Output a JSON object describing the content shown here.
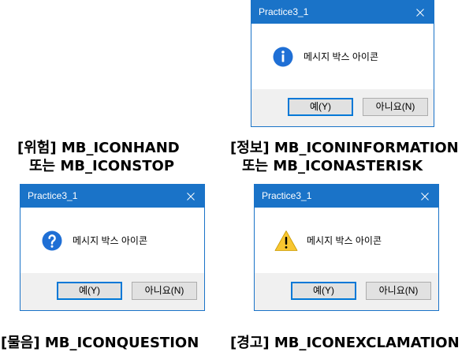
{
  "theme": {
    "title_bar_color": "#1a73c8",
    "button_strip_color": "#f0f0f0",
    "button_color": "#e1e1e1",
    "default_button_border": "#0078d7",
    "information_icon_color": "#1f6fd5",
    "question_icon_color": "#1f6fd5",
    "warning_icon_color": "#f8c630"
  },
  "captions": {
    "hand": {
      "line1": "[위험] MB_ICONHAND",
      "line2": "또는 MB_ICONSTOP"
    },
    "information": {
      "line1": "[정보] MB_ICONINFORMATION",
      "line2": "또는 MB_ICONASTERISK"
    },
    "question": {
      "line1": "[물음] MB_ICONQUESTION"
    },
    "exclamation": {
      "line1": "[경고] MB_ICONEXCLAMATION"
    }
  },
  "dialogs": {
    "information": {
      "title": "Practice3_1",
      "icon": "information-icon",
      "close_icon": "close-icon",
      "message": "메시지 박스 아이콘",
      "yes_label": "예(Y)",
      "no_label": "아니요(N)"
    },
    "question": {
      "title": "Practice3_1",
      "icon": "question-icon",
      "close_icon": "close-icon",
      "message": "메시지 박스 아이콘",
      "yes_label": "예(Y)",
      "no_label": "아니요(N)"
    },
    "exclamation": {
      "title": "Practice3_1",
      "icon": "warning-icon",
      "close_icon": "close-icon",
      "message": "메시지 박스 아이콘",
      "yes_label": "예(Y)",
      "no_label": "아니요(N)"
    }
  }
}
